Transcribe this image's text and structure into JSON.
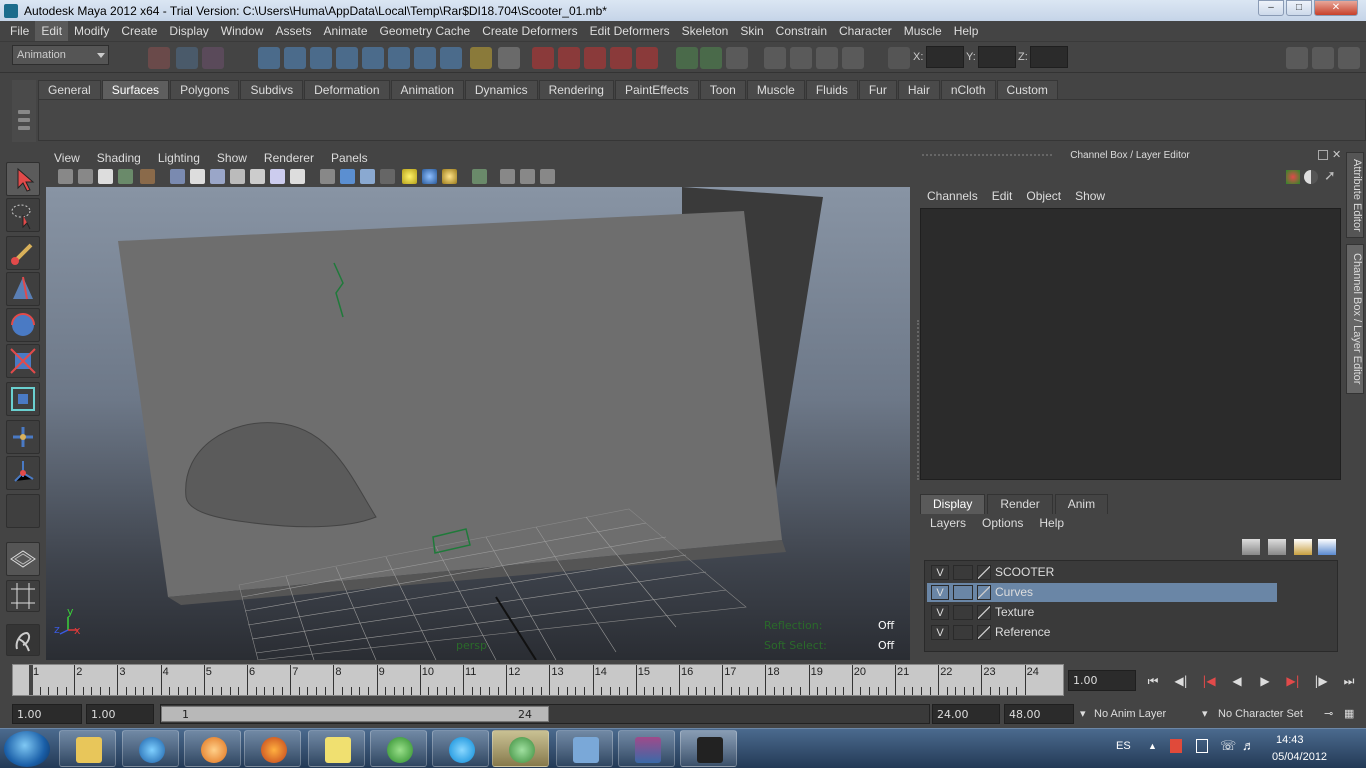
{
  "window": {
    "title": "Autodesk Maya 2012 x64 - Trial Version: C:\\Users\\Huma\\AppData\\Local\\Temp\\Rar$DI18.704\\Scooter_01.mb*"
  },
  "menubar": [
    "File",
    "Edit",
    "Modify",
    "Create",
    "Display",
    "Window",
    "Assets",
    "Animate",
    "Geometry Cache",
    "Create Deformers",
    "Edit Deformers",
    "Skeleton",
    "Skin",
    "Constrain",
    "Character",
    "Muscle",
    "Help"
  ],
  "statusline": {
    "mode": "Animation",
    "x_label": "X:",
    "y_label": "Y:",
    "z_label": "Z:"
  },
  "shelf": {
    "tabs": [
      "General",
      "Surfaces",
      "Polygons",
      "Subdivs",
      "Deformation",
      "Animation",
      "Dynamics",
      "Rendering",
      "PaintEffects",
      "Toon",
      "Muscle",
      "Fluids",
      "Fur",
      "Hair",
      "nCloth",
      "Custom"
    ],
    "active": "Surfaces"
  },
  "viewport": {
    "menu": [
      "View",
      "Shading",
      "Lighting",
      "Show",
      "Renderer",
      "Panels"
    ],
    "hud": {
      "reflection_label": "Reflection:",
      "reflection_value": "Off",
      "soft_select_label": "Soft Select:",
      "soft_select_value": "Off",
      "camera": "persp"
    },
    "axis": {
      "x": "x",
      "y": "y",
      "z": "z"
    }
  },
  "channelbox": {
    "title": "Channel Box / Layer Editor",
    "menu": [
      "Channels",
      "Edit",
      "Object",
      "Show"
    ]
  },
  "side_tabs": [
    "Attribute Editor",
    "Channel Box / Layer Editor"
  ],
  "layer_editor": {
    "tabs": [
      "Display",
      "Render",
      "Anim"
    ],
    "active_tab": "Display",
    "menu": [
      "Layers",
      "Options",
      "Help"
    ],
    "layers": [
      {
        "visible": "V",
        "name": "SCOOTER",
        "selected": false
      },
      {
        "visible": "V",
        "name": "Curves",
        "selected": true
      },
      {
        "visible": "V",
        "name": "Texture",
        "selected": false
      },
      {
        "visible": "V",
        "name": "Reference",
        "selected": false
      }
    ]
  },
  "timeline": {
    "ticks": [
      "1",
      "2",
      "3",
      "4",
      "5",
      "6",
      "7",
      "8",
      "9",
      "10",
      "11",
      "12",
      "13",
      "14",
      "15",
      "16",
      "17",
      "18",
      "19",
      "20",
      "21",
      "22",
      "23",
      "24"
    ],
    "current_time": "1.00"
  },
  "range": {
    "start": "1.00",
    "playback_start": "1.00",
    "handle_start": "1",
    "handle_end": "24",
    "playback_end": "24.00",
    "end": "48.00",
    "anim_layer": "No Anim Layer",
    "character_set": "No Character Set"
  },
  "tray": {
    "lang": "ES",
    "time": "14:43",
    "date": "05/04/2012"
  },
  "colors": {
    "selected_layer": "#6a86a6",
    "bg": "#444444"
  }
}
